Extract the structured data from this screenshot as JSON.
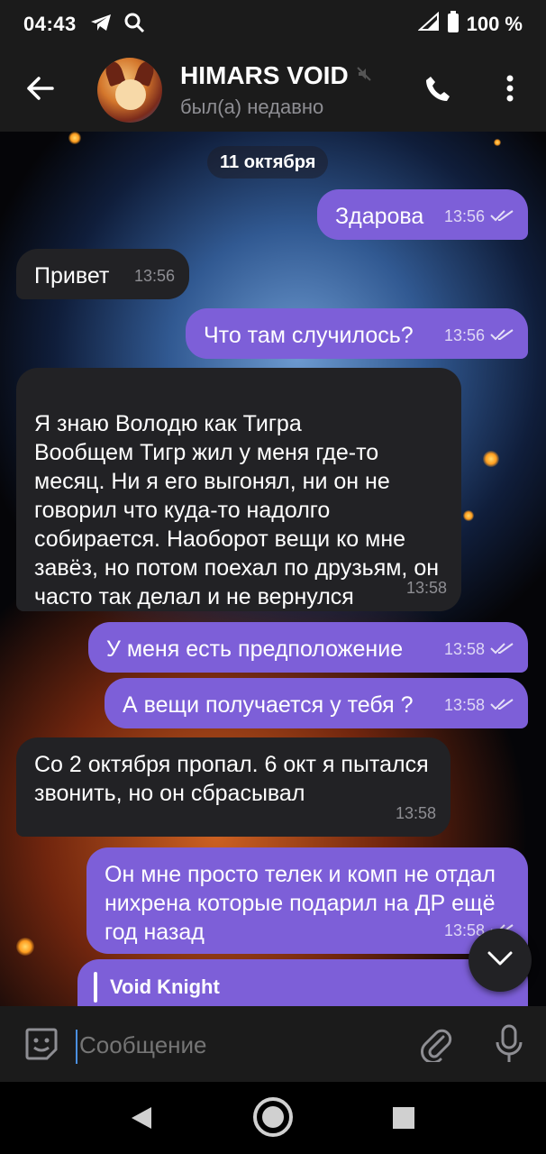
{
  "status_bar": {
    "time": "04:43",
    "battery": "100 %",
    "icons": [
      "telegram-icon",
      "search-icon",
      "signal-icon",
      "battery-icon"
    ]
  },
  "header": {
    "title": "HIMARS VOID",
    "status": "был(а) недавно",
    "muted_icon": "mute-icon",
    "back_icon": "arrow-left-icon",
    "call_icon": "phone-icon",
    "menu_icon": "more-vertical-icon"
  },
  "chat": {
    "date": "11 октября",
    "messages": [
      {
        "direction": "out",
        "text": "Здарова",
        "time": "13:56",
        "read": true
      },
      {
        "direction": "in",
        "text": "Привет",
        "time": "13:56"
      },
      {
        "direction": "out",
        "text": "Что там случилось?",
        "time": "13:56",
        "read": true
      },
      {
        "direction": "in",
        "text": "Я знаю Володю как Тигра\nВообщем Тигр жил у меня где-то месяц. Ни я его выгонял, ни он не говорил что куда-то надолго собирается. Наоборот вещи ко мне завёз, но потом поехал по друзьям, он часто так делал и не вернулся",
        "time": "13:58"
      },
      {
        "direction": "out",
        "text": "У меня есть предположение",
        "time": "13:58",
        "read": true
      },
      {
        "direction": "out",
        "text": "А вещи получается у тебя ?",
        "time": "13:58",
        "read": true
      },
      {
        "direction": "in",
        "text": "Со 2 октября пропал. 6 окт я пытался звонить, но он сбрасывал",
        "time": "13:58"
      },
      {
        "direction": "out",
        "text": "Он мне просто телек и комп не отдал нихрена которые подарил на ДР ещё год назад",
        "time": "13:58",
        "read": true
      }
    ],
    "reply_preview": {
      "name": "Void Knight"
    }
  },
  "input": {
    "placeholder": "Сообщение",
    "emoji_icon": "sticker-icon",
    "attach_icon": "paperclip-icon",
    "mic_icon": "microphone-icon"
  },
  "colors": {
    "outgoing": "#7d5fd8",
    "incoming": "#222225",
    "bar": "#1b1b1b",
    "accent": "#4a8fe0"
  }
}
